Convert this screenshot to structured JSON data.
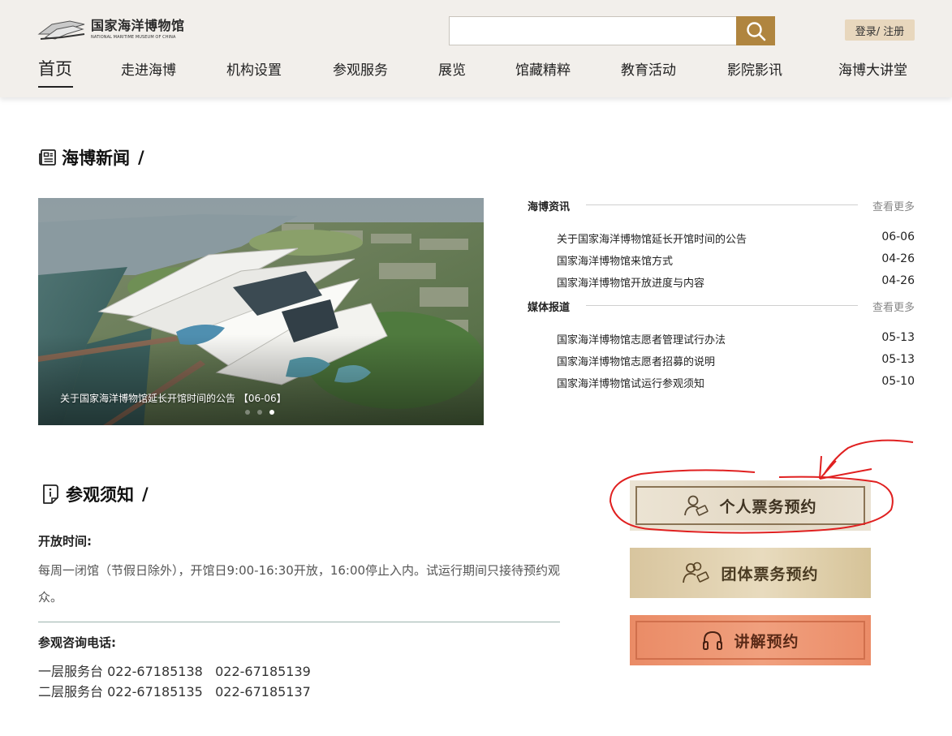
{
  "header": {
    "logo_cn": "国家海洋博物馆",
    "logo_en": "NATIONAL MARITIME MUSEUM OF CHINA",
    "search": {
      "placeholder": "",
      "value": ""
    },
    "login_label": "登录/ 注册"
  },
  "nav": {
    "items": [
      "首页",
      "走进海博",
      "机构设置",
      "参观服务",
      "展览",
      "馆藏精粹",
      "教育活动",
      "影院影讯",
      "海博大讲堂"
    ],
    "active_index": 0
  },
  "news": {
    "title": "海博新闻",
    "slash": "/",
    "carousel": {
      "caption": "关于国家海洋博物馆延长开馆时间的公告 【06-06】",
      "slide_count": 3,
      "active_slide": 3
    },
    "blocks": [
      {
        "category": "海博资讯",
        "more": "查看更多",
        "items": [
          {
            "title": "关于国家海洋博物馆延长开馆时间的公告",
            "date": "06-06"
          },
          {
            "title": "国家海洋博物馆来馆方式",
            "date": "04-26"
          },
          {
            "title": "国家海洋博物馆开放进度与内容",
            "date": "04-26"
          }
        ]
      },
      {
        "category": "媒体报道",
        "more": "查看更多",
        "items": [
          {
            "title": "国家海洋博物馆志愿者管理试行办法",
            "date": "05-13"
          },
          {
            "title": "国家海洋博物馆志愿者招募的说明",
            "date": "05-13"
          },
          {
            "title": "国家海洋博物馆试运行参观须知",
            "date": "05-10"
          }
        ]
      }
    ]
  },
  "visit": {
    "title": "参观须知",
    "slash": "/",
    "hours_label": "开放时间:",
    "hours_text": "每周一闭馆（节假日除外），开馆日9:00-16:30开放，16:00停止入内。试运行期间只接待预约观众。",
    "phone_label": "参观咨询电话:",
    "phone_lines": [
      "一层服务台 022-67185138   022-67185139",
      "二层服务台 022-67185135   022-67185137"
    ]
  },
  "booking": {
    "individual": "个人票务预约",
    "group": "团体票务预约",
    "guide": "讲解预约"
  },
  "colors": {
    "accent_gold": "#b0853f",
    "header_bg": "#f2efeb",
    "annotation_red": "#e02020",
    "guide_orange": "#ee9572"
  },
  "icons": [
    "logo-mark-icon",
    "search-icon",
    "news-icon",
    "notice-icon",
    "user-ticket-icon",
    "group-ticket-icon",
    "headphones-icon"
  ]
}
